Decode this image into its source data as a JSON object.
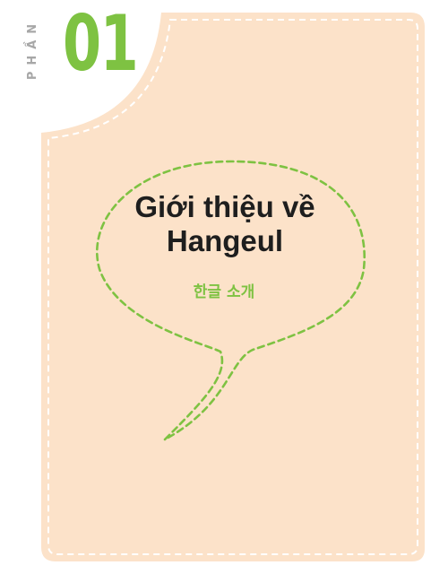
{
  "part": {
    "label": "PHẦN",
    "number": "01"
  },
  "title": {
    "line1": "Giới thiệu về",
    "line2": "Hangeul"
  },
  "subtitle": "한글 소개",
  "colors": {
    "card_fill": "#fce2c9",
    "accent_green": "#7ec242",
    "part_label_gray": "#a7a7a7",
    "title_text": "#1e1e1e",
    "dashed_border": "#ffffff"
  }
}
